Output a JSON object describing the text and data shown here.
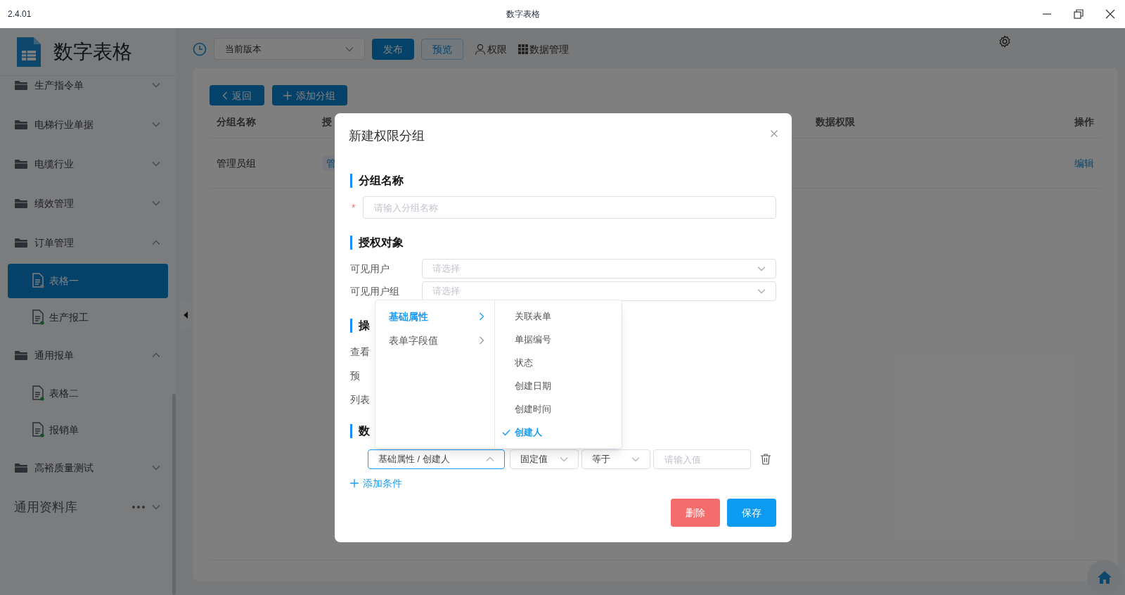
{
  "window": {
    "version": "2.4.01",
    "title": "数字表格"
  },
  "sidebar": {
    "app_name": "数字表格",
    "items": [
      {
        "label": "生产指令单",
        "expanded": false
      },
      {
        "label": "电梯行业单据",
        "expanded": false
      },
      {
        "label": "电缆行业",
        "expanded": false
      },
      {
        "label": "绩效管理",
        "expanded": false
      },
      {
        "label": "订单管理",
        "expanded": true,
        "children": [
          {
            "label": "表格一",
            "selected": true
          },
          {
            "label": "生产报工",
            "selected": false
          }
        ]
      },
      {
        "label": "通用报单",
        "expanded": true,
        "children": [
          {
            "label": "表格二",
            "selected": false
          },
          {
            "label": "报销单",
            "selected": false
          }
        ]
      },
      {
        "label": "高裕质量测试",
        "expanded": false
      }
    ],
    "library": {
      "label": "通用资料库"
    }
  },
  "toolbar": {
    "version_select": "当前版本",
    "buttons": [
      {
        "label": "发布",
        "kind": "primary"
      },
      {
        "label": "预览",
        "kind": "secondary"
      }
    ],
    "links": [
      {
        "label": "权限",
        "kind": "user"
      },
      {
        "label": "数据管理",
        "kind": "grid"
      }
    ]
  },
  "page": {
    "buttons": [
      {
        "label": "返回",
        "kind": "back"
      },
      {
        "label": "添加分组",
        "kind": "add"
      }
    ],
    "table": {
      "columns": [
        "分组名称",
        "授",
        "数据权限",
        "操作"
      ],
      "rows": [
        {
          "name": "管理员组",
          "tag": "管",
          "action": "编辑"
        }
      ]
    }
  },
  "dialog": {
    "title": "新建权限分组",
    "name_section": {
      "title": "分组名称",
      "required_mark": "*",
      "placeholder": "请输入分组名称"
    },
    "target_section": {
      "title": "授权对象",
      "fields": [
        {
          "label": "可见用户",
          "placeholder": "请选择"
        },
        {
          "label": "可见用户组",
          "placeholder": "请选择"
        }
      ]
    },
    "operation_section": {
      "title": "操",
      "rows": [
        "查看",
        "预",
        "列表"
      ]
    },
    "data_section": {
      "title": "数",
      "condition": {
        "field": "基础属性 / 创建人",
        "open": true,
        "mode": "固定值",
        "operator": "等于",
        "value_placeholder": "请输入值"
      },
      "add_label": "添加条件"
    },
    "cascader": {
      "groups": [
        {
          "label": "基础属性",
          "selected": true
        },
        {
          "label": "表单字段值",
          "selected": false
        }
      ],
      "options": [
        {
          "label": "关联表单",
          "selected": false
        },
        {
          "label": "单据编号",
          "selected": false
        },
        {
          "label": "状态",
          "selected": false
        },
        {
          "label": "创建日期",
          "selected": false
        },
        {
          "label": "创建时间",
          "selected": false
        },
        {
          "label": "创建人",
          "selected": true
        }
      ]
    },
    "buttons": [
      {
        "label": "删除",
        "kind": "danger"
      },
      {
        "label": "保存",
        "kind": "primary"
      }
    ]
  }
}
